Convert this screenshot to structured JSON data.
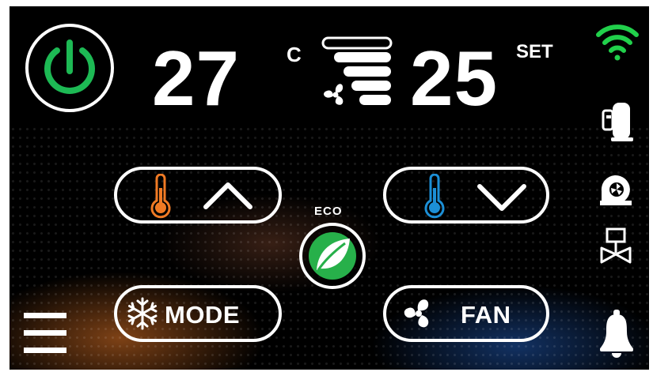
{
  "header": {
    "current_temp": "27",
    "temp_unit": "C",
    "set_temp": "25",
    "set_label": "SET"
  },
  "controls": {
    "temp_up_icon": "thermometer-up",
    "temp_down_icon": "thermometer-down",
    "eco_label": "ECO",
    "mode_label": "MODE",
    "fan_label": "FAN"
  },
  "status_icons": [
    "wifi-icon",
    "compressor-icon",
    "blower-icon",
    "valve-icon",
    "bell-icon"
  ],
  "colors": {
    "power": "#1db954",
    "wifi": "#21d04b",
    "hot": "#f07a24",
    "cold": "#1c8fd6",
    "leaf": "#27b04a",
    "foreground": "#ffffff",
    "background": "#000000"
  }
}
